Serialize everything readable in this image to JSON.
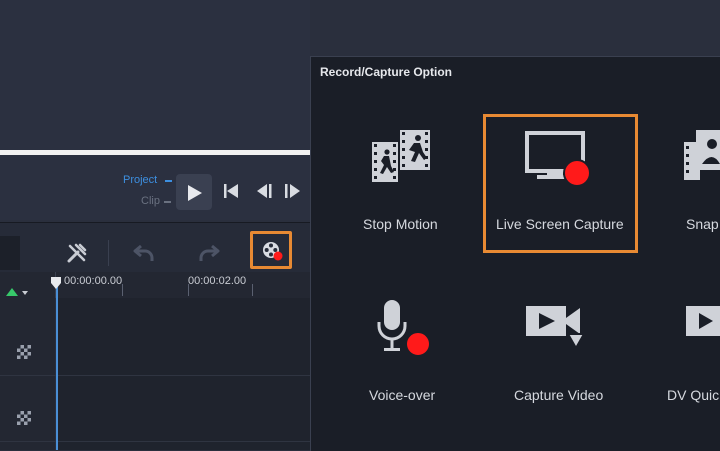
{
  "playback": {
    "mode_project": "Project",
    "mode_clip": "Clip"
  },
  "timeline": {
    "timecode_1": "00:00:00.00",
    "timecode_2": "00:00:02.00"
  },
  "capture_dialog": {
    "title": "Record/Capture Option",
    "options": [
      {
        "label": "Stop Motion",
        "icon": "stop-motion-icon"
      },
      {
        "label": "Live Screen Capture",
        "icon": "screen-capture-icon",
        "selected": true
      },
      {
        "label": "Snap",
        "icon": "snapshot-icon"
      },
      {
        "label": "Voice-over",
        "icon": "microphone-icon"
      },
      {
        "label": "Capture Video",
        "icon": "capture-video-icon"
      },
      {
        "label": "DV Quic",
        "icon": "dv-quick-scan-icon"
      }
    ]
  },
  "colors": {
    "accent_orange": "#e88a33",
    "record_red": "#ff1a1a",
    "project_blue": "#3d8fe0",
    "playhead_blue": "#4a8fd6"
  }
}
